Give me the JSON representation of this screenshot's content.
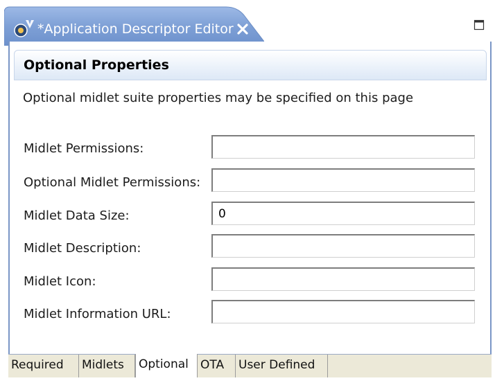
{
  "editor_tab": {
    "title": "*Application Descriptor Editor",
    "icon": "application-descriptor-icon",
    "close_icon": "close-icon",
    "maximize_icon": "maximize-icon",
    "tab_color": "#7ea0d6"
  },
  "section": {
    "title": "Optional Properties",
    "description": "Optional midlet suite properties may be specified on this page"
  },
  "fields": [
    {
      "label": "Midlet Permissions:",
      "value": ""
    },
    {
      "label": "Optional Midlet Permissions:",
      "value": ""
    },
    {
      "label": "Midlet Data Size:",
      "value": "0"
    },
    {
      "label": "Midlet Description:",
      "value": ""
    },
    {
      "label": "Midlet Icon:",
      "value": ""
    },
    {
      "label": "Midlet Information URL:",
      "value": ""
    }
  ],
  "page_tabs": [
    {
      "label": "Required",
      "selected": false
    },
    {
      "label": "Midlets",
      "selected": false
    },
    {
      "label": "Optional",
      "selected": true
    },
    {
      "label": "OTA",
      "selected": false
    },
    {
      "label": "User Defined",
      "selected": false
    }
  ]
}
